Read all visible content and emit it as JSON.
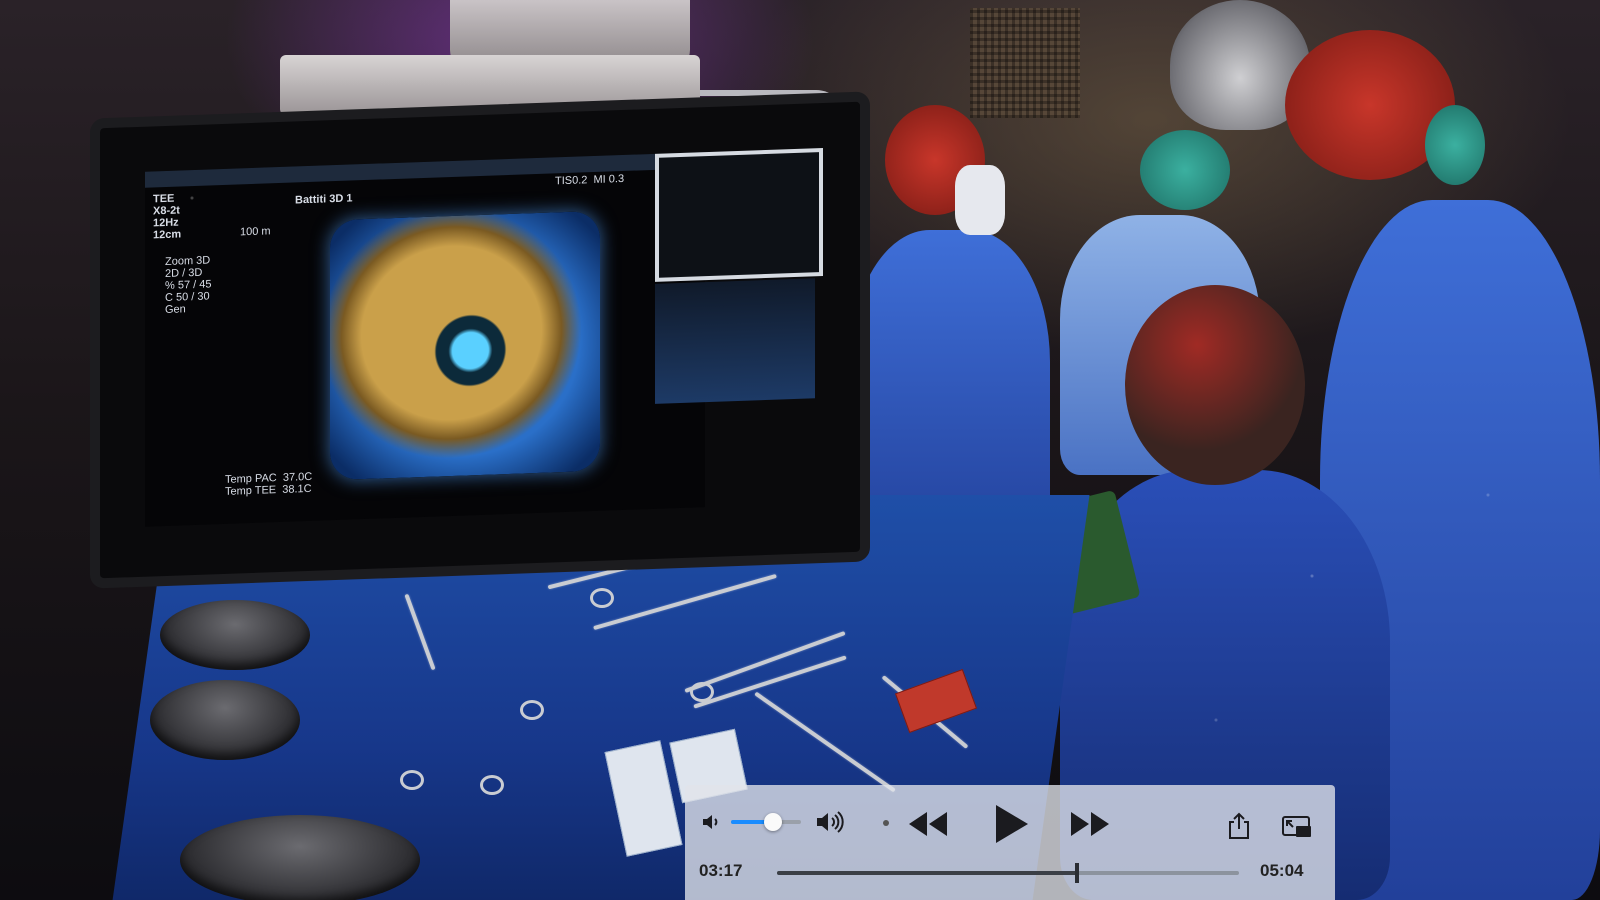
{
  "monitor": {
    "mode_lines": "TEE\nX8-2t\n12Hz\n12cm",
    "title": "Battiti 3D 1",
    "zoom_lines": "Zoom 3D\n2D / 3D\n% 57 / 45\nC 50 / 30\nGen",
    "scale": "100 m",
    "top_right": "TIS0.2  MI 0.3",
    "temp_lines": "Temp PAC  37.0C\nTemp TEE  38.1C"
  },
  "player": {
    "current_time": "03:17",
    "total_time": "05:04",
    "volume_fraction": 0.6,
    "progress_fraction": 0.65,
    "icons": {
      "volume_low": "speaker-low-icon",
      "volume_high": "speaker-high-icon",
      "rewind": "rewind-icon",
      "play": "play-icon",
      "fast_forward": "fast-forward-icon",
      "share": "share-icon",
      "picture_in_picture": "picture-in-picture-icon"
    },
    "accent_color": "#1a8cff"
  }
}
